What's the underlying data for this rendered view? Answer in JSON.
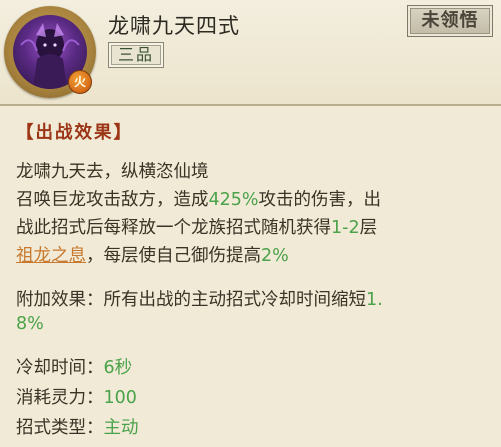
{
  "header": {
    "skill_name": "龙啸九天四式",
    "grade": "三品",
    "element": "火",
    "status_button": "未领悟"
  },
  "effect": {
    "section_title": "【出战效果】",
    "line1": "龙啸九天去，纵横恣仙境",
    "line2_a": "召唤巨龙攻击敌方，造成",
    "line2_pct": "425%",
    "line2_b": "攻击的伤害，出",
    "line3_a": "战此招式后每释放一个龙族招式随机获得",
    "line3_range": "1-2",
    "line3_b": "层",
    "line4_link": "祖龙之息",
    "line4_a": "，每层使自己御伤提高",
    "line4_pct": "2%"
  },
  "extra": {
    "line5_label": "附加效果：",
    "line5_text": "所有出战的主动招式冷却时间缩短",
    "line5_val_a": "1.",
    "line6_val_b": "8%"
  },
  "stats": {
    "cooldown_label": "冷却时间：",
    "cooldown_value": "6秒",
    "cost_label": "消耗灵力：",
    "cost_value": "100",
    "type_label": "招式类型：",
    "type_value": "主动"
  },
  "colors": {
    "highlight_green": "#4ba24a",
    "title_red": "#9b3515",
    "link_orange": "#c77a2f"
  },
  "icons": {
    "avatar": "dragon-warrior-portrait",
    "element_badge": "fire-element-icon"
  }
}
